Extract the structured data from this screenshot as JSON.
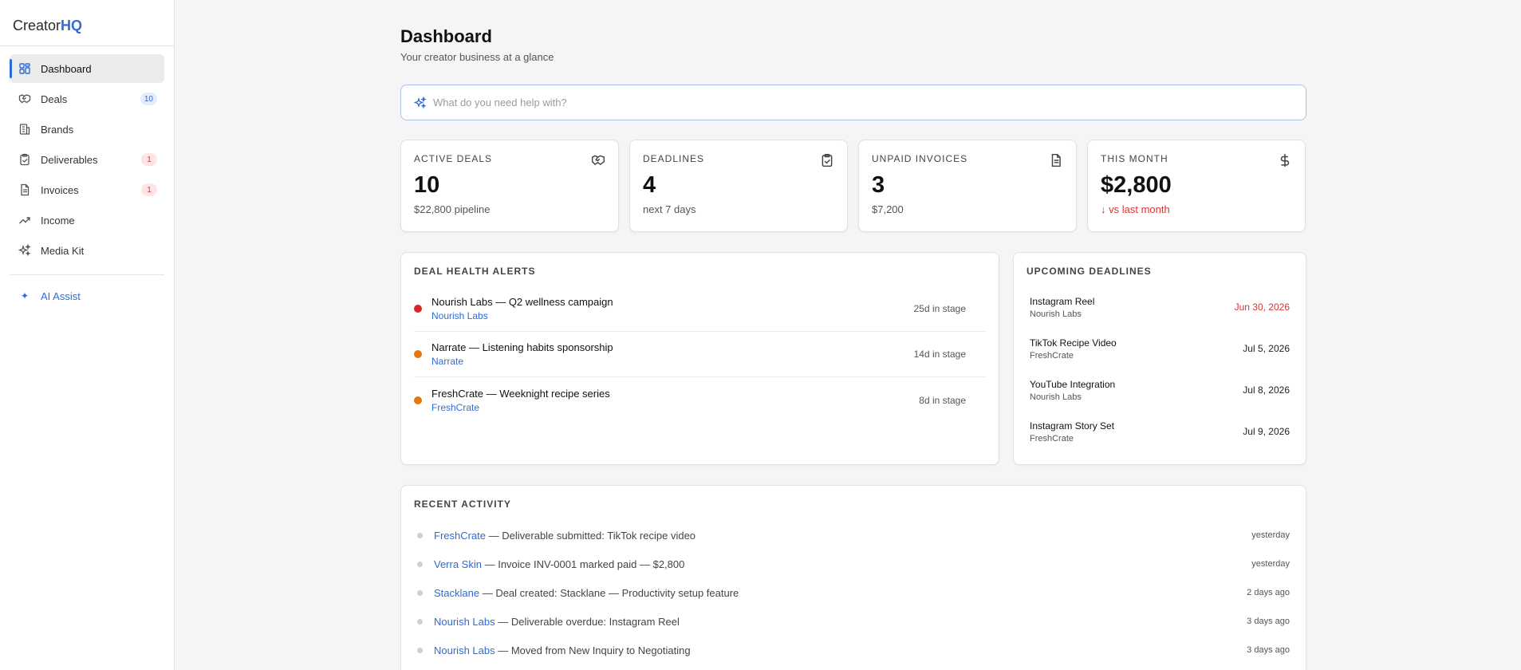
{
  "app": {
    "logo_main": "Creator",
    "logo_accent": "HQ"
  },
  "sidebar": {
    "items": [
      {
        "label": "Dashboard",
        "icon": "grid-icon",
        "badge": ""
      },
      {
        "label": "Deals",
        "icon": "handshake-icon",
        "badge": "10"
      },
      {
        "label": "Brands",
        "icon": "building-icon",
        "badge": ""
      },
      {
        "label": "Deliverables",
        "icon": "clipboard-check-icon",
        "badge": "1"
      },
      {
        "label": "Invoices",
        "icon": "document-icon",
        "badge": "1"
      },
      {
        "label": "Income",
        "icon": "trending-up-icon",
        "badge": ""
      },
      {
        "label": "Media Kit",
        "icon": "sparkles-icon",
        "badge": ""
      }
    ],
    "ai_assist": {
      "icon_glyph": "✦",
      "label": "AI Assist"
    }
  },
  "header": {
    "title": "Dashboard",
    "subtitle": "Your creator business at a glance"
  },
  "ask": {
    "placeholder": "What do you need help with?",
    "value": ""
  },
  "stats": [
    {
      "label": "ACTIVE DEALS",
      "value": "10",
      "sub": "$22,800 pipeline",
      "icon": "handshake-icon"
    },
    {
      "label": "DEADLINES",
      "value": "4",
      "sub": "next 7 days",
      "icon": "clipboard-check-icon"
    },
    {
      "label": "UNPAID INVOICES",
      "value": "3",
      "sub": "$7,200",
      "icon": "document-icon"
    },
    {
      "label": "THIS MONTH",
      "value": "$2,800",
      "sub": "↓ vs last month",
      "icon": "dollar-icon"
    }
  ],
  "alerts": {
    "title": "DEAL HEALTH ALERTS",
    "rows": [
      {
        "name": "Nourish Labs — Q2 wellness campaign",
        "brand": "Nourish Labs",
        "stage": "25d in stage",
        "severity_color": "#d62828"
      },
      {
        "name": "Narrate — Listening habits sponsorship",
        "brand": "Narrate",
        "stage": "14d in stage",
        "severity_color": "#e07a10"
      },
      {
        "name": "FreshCrate — Weeknight recipe series",
        "brand": "FreshCrate",
        "stage": "8d in stage",
        "severity_color": "#e07a10"
      }
    ]
  },
  "deadlines": {
    "title": "UPCOMING DEADLINES",
    "rows": [
      {
        "name": "Instagram Reel",
        "brand": "Nourish Labs",
        "date": "Jun 30, 2026"
      },
      {
        "name": "TikTok Recipe Video",
        "brand": "FreshCrate",
        "date": "Jul 5, 2026"
      },
      {
        "name": "YouTube Integration",
        "brand": "Nourish Labs",
        "date": "Jul 8, 2026"
      },
      {
        "name": "Instagram Story Set",
        "brand": "FreshCrate",
        "date": "Jul 9, 2026"
      }
    ]
  },
  "activity": {
    "title": "RECENT ACTIVITY",
    "rows": [
      {
        "brand": "FreshCrate",
        "text": " — Deliverable submitted: TikTok recipe video",
        "time": "yesterday"
      },
      {
        "brand": "Verra Skin",
        "text": " — Invoice INV-0001 marked paid — $2,800",
        "time": "yesterday"
      },
      {
        "brand": "Stacklane",
        "text": " — Deal created: Stacklane — Productivity setup feature",
        "time": "2 days ago"
      },
      {
        "brand": "Nourish Labs",
        "text": " — Deliverable overdue: Instagram Reel",
        "time": "3 days ago"
      },
      {
        "brand": "Nourish Labs",
        "text": " — Moved from New Inquiry to Negotiating",
        "time": "3 days ago"
      }
    ]
  },
  "colors": {
    "accent": "#2f6bd8",
    "danger": "#d33",
    "warning": "#e07a10"
  }
}
